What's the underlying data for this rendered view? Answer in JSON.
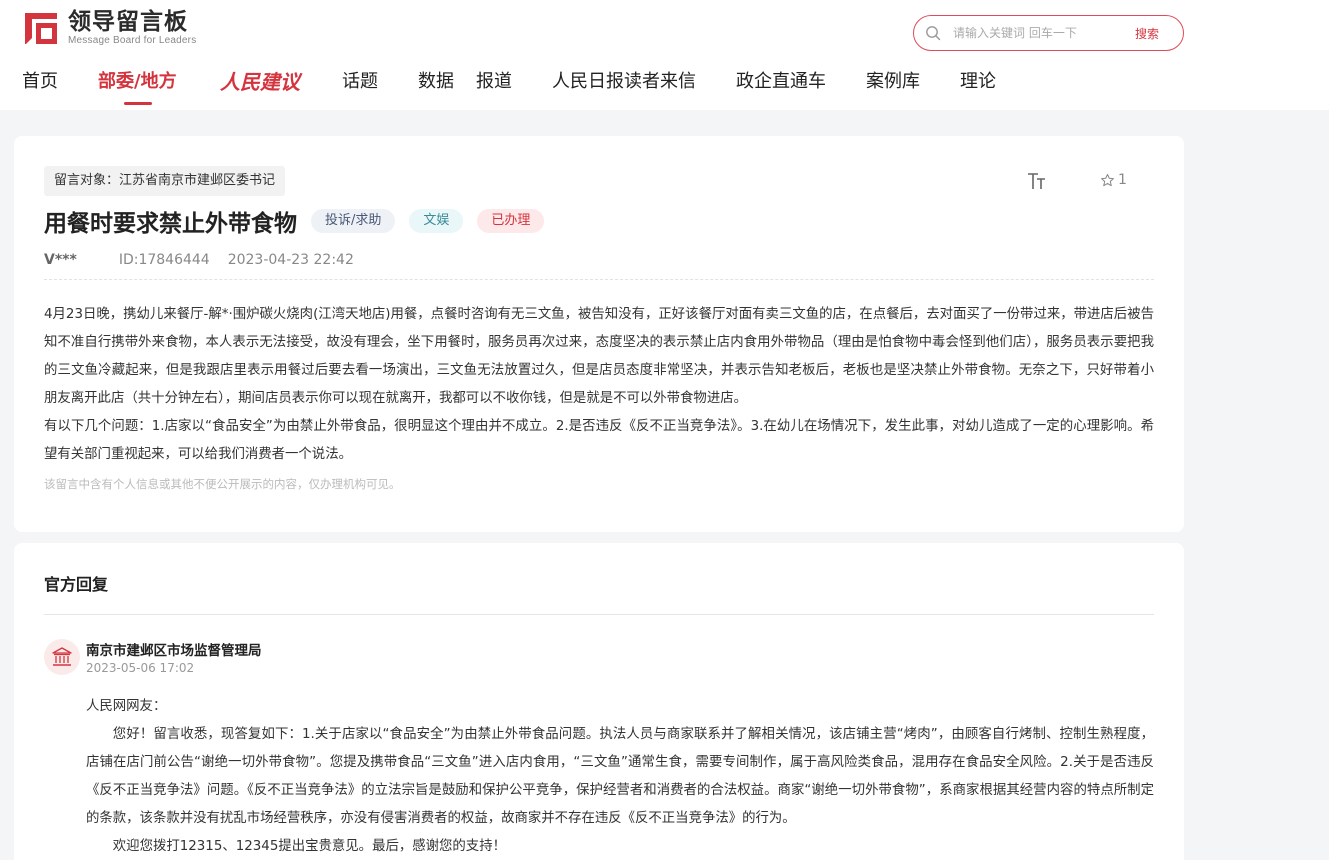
{
  "header": {
    "logo_title": "领导留言板",
    "logo_subtitle": "Message Board for Leaders",
    "search_placeholder": "请输入关键词 回车一下",
    "search_button": "搜索",
    "nav": [
      {
        "label": "首页",
        "active": false
      },
      {
        "label": "部委/地方",
        "active": true
      },
      {
        "label": "人民建议",
        "active": false
      },
      {
        "label": "话题",
        "active": false
      },
      {
        "label": "数据",
        "active": false
      },
      {
        "label": "报道",
        "active": false
      },
      {
        "label": "人民日报读者来信",
        "active": false
      },
      {
        "label": "政企直通车",
        "active": false
      },
      {
        "label": "案例库",
        "active": false
      },
      {
        "label": "理论",
        "active": false
      }
    ]
  },
  "message": {
    "target": "留言对象：江苏省南京市建邺区委书记",
    "title": "用餐时要求禁止外带食物",
    "tags": {
      "type": "投诉/求助",
      "field": "文娱",
      "status": "已办理"
    },
    "user": "V***",
    "id": "ID:17846444",
    "time": "2023-04-23 22:42",
    "favorite_count": "1",
    "paragraphs": [
      "4月23日晚，携幼儿来餐厅-解*·围炉碳火烧肉(江湾天地店)用餐，点餐时咨询有无三文鱼，被告知没有，正好该餐厅对面有卖三文鱼的店，在点餐后，去对面买了一份带过来，带进店后被告知不准自行携带外来食物，本人表示无法接受，故没有理会，坐下用餐时，服务员再次过来，态度坚决的表示禁止店内食用外带物品（理由是怕食物中毒会怪到他们店），服务员表示要把我的三文鱼冷藏起来，但是我跟店里表示用餐过后要去看一场演出，三文鱼无法放置过久，但是店员态度非常坚决，并表示告知老板后，老板也是坚决禁止外带食物。无奈之下，只好带着小朋友离开此店（共十分钟左右），期间店员表示你可以现在就离开，我都可以不收你钱，但是就是不可以外带食物进店。",
      "有以下几个问题：1.店家以“食品安全”为由禁止外带食品，很明显这个理由并不成立。2.是否违反《反不正当竞争法》。3.在幼儿在场情况下，发生此事，对幼儿造成了一定的心理影响。希望有关部门重视起来，可以给我们消费者一个说法。"
    ],
    "notice": "该留言中含有个人信息或其他不便公开展示的内容，仅办理机构可见。"
  },
  "reply": {
    "heading": "官方回复",
    "org": "南京市建邺区市场监督管理局",
    "time": "2023-05-06 17:02",
    "greeting": "人民网网友：",
    "paragraphs": [
      "您好！留言收悉，现答复如下：1.关于店家以“食品安全”为由禁止外带食品问题。执法人员与商家联系并了解相关情况，该店铺主营“烤肉”，由顾客自行烤制、控制生熟程度，店铺在店门前公告“谢绝一切外带食物”。您提及携带食品“三文鱼”进入店内食用，“三文鱼”通常生食，需要专间制作，属于高风险类食品，混用存在食品安全风险。2.关于是否违反《反不正当竞争法》问题。《反不正当竞争法》的立法宗旨是鼓励和保护公平竞争，保护经营者和消费者的合法权益。商家“谢绝一切外带食物”，系商家根据其经营内容的特点所制定的条款，该条款并没有扰乱市场经营秩序，亦没有侵害消费者的权益，故商家并不存在违反《反不正当竞争法》的行为。",
      "欢迎您拨打12315、12345提出宝贵意见。最后，感谢您的支持！"
    ]
  },
  "colors": {
    "accent": "#d4343e",
    "background": "#f4f5f7"
  }
}
